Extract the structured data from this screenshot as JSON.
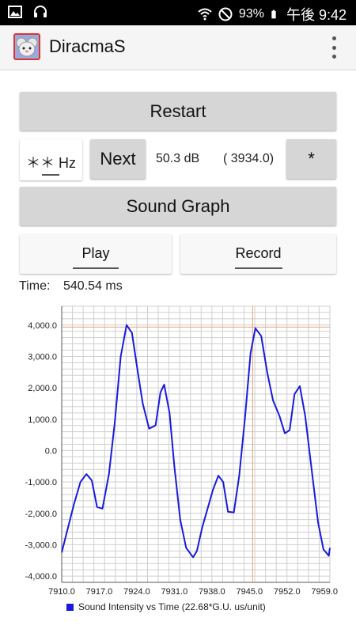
{
  "status_bar": {
    "battery": "93%",
    "time": "午後 9:42"
  },
  "app": {
    "title": "DiracmaS",
    "icon": "mouse-face-icon"
  },
  "controls": {
    "restart_label": "Restart",
    "hz_label": "＊＊ Hz",
    "next_label": "Next",
    "db_value": "50.3 dB",
    "freq_value": "( 3934.0)",
    "star_label": "*",
    "sound_graph_label": "Sound Graph",
    "play_label": "Play",
    "record_label": "Record"
  },
  "time_readout": {
    "label": "Time:",
    "value": "540.54 ms"
  },
  "colors": {
    "line": "#1a1adf",
    "crosshair": "#e8a070",
    "grid": "#cfcfcf",
    "button": "#d6d6d6"
  },
  "chart_data": {
    "type": "line",
    "xlim": [
      7910.0,
      7960.0
    ],
    "ylim": [
      -4200,
      4600
    ],
    "x_ticks": [
      7910.0,
      7917.0,
      7924.0,
      7931.0,
      7938.0,
      7945.0,
      7952.0,
      7959.0
    ],
    "x_tick_labels": [
      "7910.0",
      "7917.0",
      "7924.0",
      "7931.0",
      "7938.0",
      "7945.0",
      "7952.0",
      "7959.0"
    ],
    "y_ticks": [
      4000,
      3000,
      2000,
      1000,
      0,
      -1000,
      -2000,
      -3000,
      -4000
    ],
    "y_tick_labels": [
      "4,000.0",
      "3,000.0",
      "2,000.0",
      "1,000.0",
      "0.0",
      "-1,000.0",
      "-2,000.0",
      "-3,000.0",
      "-4,000.0"
    ],
    "grid": true,
    "legend_position": "bottom-left",
    "crosshair": {
      "x": 7945.6,
      "y": 3934.0
    },
    "series": [
      {
        "name": "Sound Intensity vs Time (22.68*G.U. us/unit)",
        "x": [
          7910.0,
          7911.1,
          7912.3,
          7913.5,
          7914.6,
          7915.6,
          7916.6,
          7917.6,
          7918.8,
          7919.9,
          7921.0,
          7922.1,
          7923.1,
          7924.1,
          7925.1,
          7926.3,
          7927.5,
          7928.4,
          7929.1,
          7930.1,
          7931.0,
          7932.1,
          7933.2,
          7934.5,
          7935.2,
          7936.2,
          7937.2,
          7938.2,
          7939.2,
          7940.1,
          7941.0,
          7942.1,
          7943.1,
          7944.2,
          7945.2,
          7946.1,
          7947.2,
          7948.3,
          7949.4,
          7950.6,
          7951.6,
          7952.5,
          7953.4,
          7954.4,
          7955.4,
          7956.6,
          7957.8,
          7958.8,
          7959.8,
          7960.0
        ],
        "values": [
          -3250,
          -2500,
          -1700,
          -1000,
          -750,
          -950,
          -1800,
          -1850,
          -750,
          900,
          3000,
          4000,
          3750,
          2600,
          1500,
          700,
          800,
          1850,
          2100,
          1200,
          -500,
          -2200,
          -3100,
          -3400,
          -3200,
          -2450,
          -1850,
          -1250,
          -800,
          -1000,
          -1950,
          -1970,
          -800,
          1100,
          3100,
          3900,
          3650,
          2500,
          1600,
          1100,
          550,
          650,
          1800,
          2050,
          1100,
          -600,
          -2300,
          -3150,
          -3350,
          -3100
        ]
      }
    ]
  }
}
